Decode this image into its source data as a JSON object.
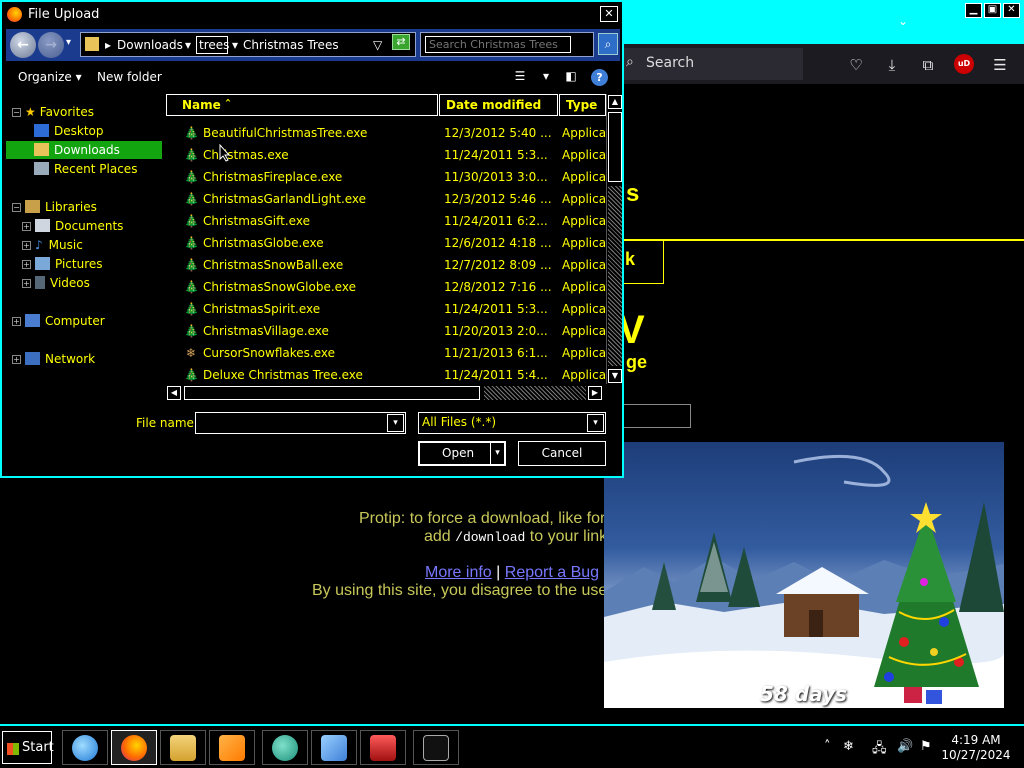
{
  "dialog": {
    "title": "File Upload",
    "close_glyph": "✕",
    "back_glyph": "←",
    "forward_glyph": "→",
    "history_glyph": "▾",
    "address": {
      "chevron": "▸",
      "segment_1": "Downloads",
      "seg_dropdown": "▾",
      "typed": "trees",
      "typed_dropdown": "▾",
      "autocomplete": "Christmas Trees",
      "dropdown": "▽",
      "refresh_glyph": "⇄"
    },
    "search_placeholder": "Search Christmas Trees",
    "search_glyph": "⌕",
    "toolbar": {
      "organize": "Organize",
      "organize_arrow": "▾",
      "new_folder": "New folder",
      "view_glyph": "☰",
      "view_dropdown": "▾",
      "preview_glyph": "◧",
      "help_glyph": "?"
    },
    "nav_pane": {
      "favorites": "Favorites",
      "desktop": "Desktop",
      "downloads": "Downloads",
      "recent_places": "Recent Places",
      "libraries": "Libraries",
      "documents": "Documents",
      "music": "Music",
      "pictures": "Pictures",
      "videos": "Videos",
      "computer": "Computer",
      "network": "Network",
      "collapse_glyph": "−",
      "expand_glyph": "+",
      "star_glyph": "★",
      "music_glyph": "♪"
    },
    "columns": {
      "name": "Name",
      "sort_glyph": "ˆ",
      "date_modified": "Date modified",
      "type": "Type"
    },
    "files": [
      {
        "name": "BeautifulChristmasTree.exe",
        "date": "12/3/2012 5:40 ...",
        "type": "Applicati",
        "icon": "🎄"
      },
      {
        "name": "Christmas.exe",
        "date": "11/24/2011 5:3...",
        "type": "Applicati",
        "icon": "🎄"
      },
      {
        "name": "ChristmasFireplace.exe",
        "date": "11/30/2013 3:0...",
        "type": "Applicati",
        "icon": "🎄"
      },
      {
        "name": "ChristmasGarlandLight.exe",
        "date": "12/3/2012 5:46 ...",
        "type": "Applicati",
        "icon": "🎄"
      },
      {
        "name": "ChristmasGift.exe",
        "date": "11/24/2011 6:2...",
        "type": "Applicati",
        "icon": "🎄"
      },
      {
        "name": "ChristmasGlobe.exe",
        "date": "12/6/2012 4:18 ...",
        "type": "Applicati",
        "icon": "🎄"
      },
      {
        "name": "ChristmasSnowBall.exe",
        "date": "12/7/2012 8:09 ...",
        "type": "Applicati",
        "icon": "🎄"
      },
      {
        "name": "ChristmasSnowGlobe.exe",
        "date": "12/8/2012 7:16 ...",
        "type": "Applicati",
        "icon": "🎄"
      },
      {
        "name": "ChristmasSpirit.exe",
        "date": "11/24/2011 5:3...",
        "type": "Applicati",
        "icon": "🎄"
      },
      {
        "name": "ChristmasVillage.exe",
        "date": "11/20/2013 2:0...",
        "type": "Applicati",
        "icon": "🎄"
      },
      {
        "name": "CursorSnowflakes.exe",
        "date": "11/21/2013 6:1...",
        "type": "Applicati",
        "icon": "❄"
      },
      {
        "name": "Deluxe Christmas Tree.exe",
        "date": "11/24/2011 5:4...",
        "type": "Applicati",
        "icon": "🎄"
      }
    ],
    "scroll": {
      "up": "▲",
      "down": "▼",
      "left": "◀",
      "right": "▶"
    },
    "file_name_label": "File name:",
    "file_name_value": "",
    "combo_arrow": "▾",
    "file_type_filter": "All Files (*.*)",
    "open_button": "Open",
    "open_split": "▾",
    "cancel_button": "Cancel"
  },
  "browser": {
    "search_placeholder": "Search",
    "search_glyph": "⌕",
    "tab_chevron": "⌄",
    "window_controls": {
      "minimize": "▁",
      "maximize": "▣",
      "close": "✕"
    },
    "toolbar_icons": {
      "pocket": "♡",
      "downloads": "⤓",
      "extensions": "⧉",
      "ublock": "uD",
      "menu": "☰"
    },
    "page_fragments": {
      "frag_s": "s",
      "frag_k": "k",
      "frag_v": "V",
      "frag_ge": "ge"
    },
    "protip_line1": "Protip: to force a download, like for",
    "protip_add": "add ",
    "protip_code": "/download",
    "protip_line2_rest": " to your link",
    "more_info": "More info",
    "separator": "|",
    "report_bug": "Report a Bug",
    "disclaimer": "By using this site, you disagree to the use"
  },
  "xmas_widget": {
    "countdown": "58 days"
  },
  "taskbar": {
    "start": "Start",
    "tray_chevron": "˄",
    "tray_snow": "❄",
    "tray_network": "🖧",
    "tray_volume": "🔊",
    "tray_flag": "⚑",
    "time": "4:19 AM",
    "date": "10/27/2024"
  },
  "colors": {
    "accent": "#00ffff",
    "text_yellow": "#ffff00",
    "selection_green": "#13a50f",
    "nav_blue": "#1b3b8f"
  }
}
